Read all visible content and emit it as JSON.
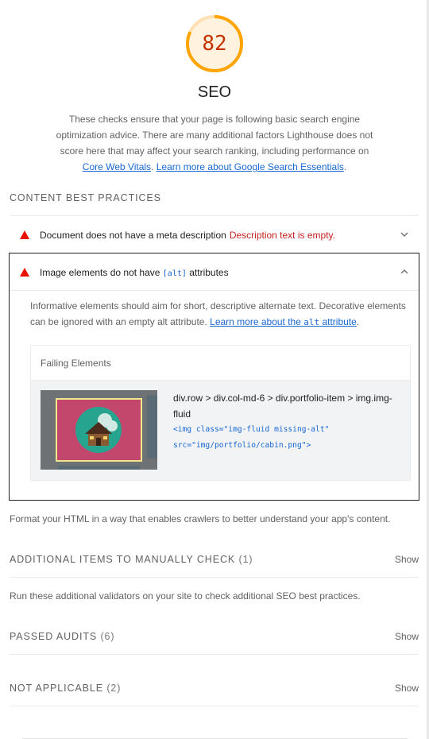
{
  "category": {
    "score": "82",
    "score_fraction": 0.82,
    "score_color": "#ffa400",
    "score_text_color": "#c33300",
    "title": "SEO",
    "description": "These checks ensure that your page is following basic search engine optimization advice. There are many additional factors Lighthouse does not score here that may affect your search ranking, including performance on",
    "link_core_web_vitals": "Core Web Vitals",
    "sep_period": ".",
    "link_search_essentials": "Learn more about Google Search Essentials",
    "end_period": "."
  },
  "content_best_practices": {
    "title": "CONTENT BEST PRACTICES",
    "audits": [
      {
        "title": "Document does not have a meta description",
        "display_value": "Description text is empty.",
        "icon": "warning-triangle-icon",
        "expanded": false
      },
      {
        "title_before": "Image elements do not have",
        "title_code": "[alt]",
        "title_after": "attributes",
        "icon": "warning-triangle-icon",
        "expanded": true,
        "description": "Informative elements should aim for short, descriptive alternate text. Decorative elements can be ignored with an empty alt attribute.",
        "learn_more_before": "Learn more about the",
        "learn_more_code": "alt",
        "learn_more_after": "attribute",
        "learn_more_period": ".",
        "failing_elements_header": "Failing Elements",
        "items": [
          {
            "selector": "div.row > div.col-md-6 > div.portfolio-item > img.img-fluid",
            "snippet_line1": "<img class=\"img-fluid missing-alt\"",
            "snippet_line2": "src=\"img/portfolio/cabin.png\">",
            "thumbnail": "cabin-thumbnail"
          }
        ]
      }
    ],
    "group_description": "Format your HTML in a way that enables crawlers to better understand your app's content."
  },
  "manual": {
    "title": "ADDITIONAL ITEMS TO MANUALLY CHECK",
    "count": "(1)",
    "toggle": "Show",
    "description": "Run these additional validators on your site to check additional SEO best practices."
  },
  "passed": {
    "title": "PASSED AUDITS",
    "count": "(6)",
    "toggle": "Show"
  },
  "not_applicable": {
    "title": "NOT APPLICABLE",
    "count": "(2)",
    "toggle": "Show"
  },
  "colors": {
    "warning": "#eb0f00",
    "link": "#1967d2",
    "fail_text": "#c5221f"
  }
}
